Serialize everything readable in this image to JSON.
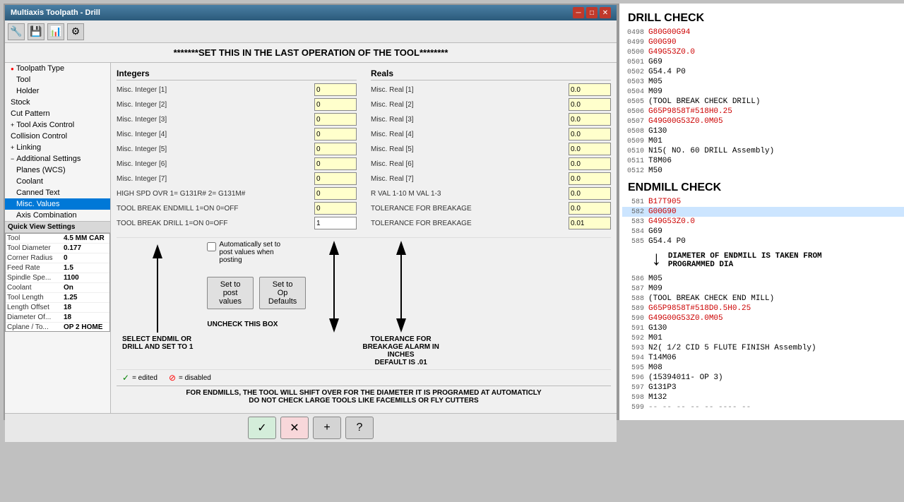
{
  "window": {
    "title": "Multiaxis Toolpath - Drill"
  },
  "toolbar": {
    "buttons": [
      "🔧",
      "💾",
      "📊",
      "⚙"
    ]
  },
  "header": {
    "title": "*******SET THIS IN THE LAST OPERATION OF THE TOOL********"
  },
  "sidebar": {
    "items": [
      {
        "id": "toolpath-type",
        "label": "Toolpath Type",
        "indent": 0,
        "icon": "●",
        "icon_color": "red"
      },
      {
        "id": "tool",
        "label": "Tool",
        "indent": 1,
        "icon": ""
      },
      {
        "id": "holder",
        "label": "Holder",
        "indent": 1,
        "icon": ""
      },
      {
        "id": "stock",
        "label": "Stock",
        "indent": 0,
        "icon": ""
      },
      {
        "id": "cut-pattern",
        "label": "Cut Pattern",
        "indent": 0,
        "icon": ""
      },
      {
        "id": "tool-axis-control",
        "label": "Tool Axis Control",
        "indent": 0,
        "icon": "+"
      },
      {
        "id": "collision-control",
        "label": "Collision Control",
        "indent": 0,
        "icon": ""
      },
      {
        "id": "linking",
        "label": "Linking",
        "indent": 0,
        "icon": "+"
      },
      {
        "id": "additional-settings",
        "label": "Additional Settings",
        "indent": 0,
        "icon": "-"
      },
      {
        "id": "planes-wcs",
        "label": "Planes (WCS)",
        "indent": 1,
        "icon": ""
      },
      {
        "id": "coolant",
        "label": "Coolant",
        "indent": 1,
        "icon": ""
      },
      {
        "id": "canned-text",
        "label": "Canned Text",
        "indent": 1,
        "icon": ""
      },
      {
        "id": "misc-values",
        "label": "Misc. Values",
        "indent": 1,
        "icon": "",
        "selected": true
      },
      {
        "id": "axis-combination",
        "label": "Axis Combination",
        "indent": 1,
        "icon": ""
      }
    ]
  },
  "quick_view": {
    "title": "Quick View Settings",
    "rows": [
      {
        "label": "Tool",
        "value": "4.5 MM CAR"
      },
      {
        "label": "Tool Diameter",
        "value": "0.177"
      },
      {
        "label": "Corner Radius",
        "value": "0"
      },
      {
        "label": "Feed Rate",
        "value": "1.5"
      },
      {
        "label": "Spindle Spe...",
        "value": "1100"
      },
      {
        "label": "Coolant",
        "value": "On"
      },
      {
        "label": "Tool Length",
        "value": "1.25"
      },
      {
        "label": "Length Offset",
        "value": "18"
      },
      {
        "label": "Diameter Of...",
        "value": "18"
      },
      {
        "label": "Cplane / To...",
        "value": "OP 2 HOME"
      }
    ]
  },
  "integers": {
    "title": "Integers",
    "rows": [
      {
        "label": "Misc. Integer [1]",
        "value": "0"
      },
      {
        "label": "Misc. Integer [2]",
        "value": "0"
      },
      {
        "label": "Misc. Integer [3]",
        "value": "0"
      },
      {
        "label": "Misc. Integer [4]",
        "value": "0"
      },
      {
        "label": "Misc. Integer [5]",
        "value": "0"
      },
      {
        "label": "Misc. Integer [6]",
        "value": "0"
      },
      {
        "label": "Misc. Integer [7]",
        "value": "0"
      },
      {
        "label": "HIGH SPD OVR 1= G131R# 2= G131M#",
        "value": "0"
      },
      {
        "label": "TOOL BREAK ENDMILL  1=ON 0=OFF",
        "value": "0"
      },
      {
        "label": "TOOL BREAK DRILL    1=ON 0=OFF",
        "value": "1"
      }
    ]
  },
  "reals": {
    "title": "Reals",
    "rows": [
      {
        "label": "Misc. Real [1]",
        "value": "0.0"
      },
      {
        "label": "Misc. Real [2]",
        "value": "0.0"
      },
      {
        "label": "Misc. Real [3]",
        "value": "0.0"
      },
      {
        "label": "Misc. Real [4]",
        "value": "0.0"
      },
      {
        "label": "Misc. Real [5]",
        "value": "0.0"
      },
      {
        "label": "Misc. Real [6]",
        "value": "0.0"
      },
      {
        "label": "Misc. Real [7]",
        "value": "0.0"
      },
      {
        "label": "R VAL 1-10 M VAL 1-3",
        "value": "0.0"
      },
      {
        "label": "TOLERANCE FOR BREAKAGE",
        "value": "0.0"
      },
      {
        "label": "TOLERANCE FOR BREAKAGE",
        "value": "0.01"
      }
    ]
  },
  "bottom_info": {
    "line1": "FOR ENDMILLS, THE TOOL WILL SHIFT OVER FOR THE DIAMETER IT IS PROGRAMED AT AUTOMATICLY",
    "line2": "DO NOT CHECK LARGE TOOLS LIKE FACEMILLS OR FLY CUTTERS"
  },
  "annotations": {
    "uncheck_box": "UNCHECK THIS BOX",
    "select_and_set": "SELECT ENDMIL OR\nDRILL AND SET TO 1",
    "tolerance": "TOLERANCE FOR\nBREAKAGE ALARM IN\nINCHES\nDEFAULT IS .01",
    "checkbox_auto": "Automatically set to\npost values when\nposting",
    "diameter_note": "DIAMETER OF ENDMILL IS TAKEN FROM\nPROGRAMMED DIA"
  },
  "buttons": {
    "set_to_post": "Set to post values",
    "set_to_op": "Set to Op Defaults",
    "ok": "✓",
    "cancel": "✕",
    "add": "+",
    "help": "?"
  },
  "legend": {
    "edited": "= edited",
    "disabled": "= disabled"
  },
  "drill_check": {
    "title": "DRILL CHECK",
    "lines": [
      {
        "num": "0498",
        "code": "G80G00G94",
        "style": "red"
      },
      {
        "num": "0499",
        "code": "G00G90",
        "style": "red"
      },
      {
        "num": "0500",
        "code": "G49G53Z0.0",
        "style": "red"
      },
      {
        "num": "0501",
        "code": "G69",
        "style": "black"
      },
      {
        "num": "0502",
        "code": "G54.4 P0",
        "style": "black"
      },
      {
        "num": "0503",
        "code": "M05",
        "style": "black"
      },
      {
        "num": "0504",
        "code": "M09",
        "style": "black"
      },
      {
        "num": "0505",
        "code": "(TOOL BREAK CHECK DRILL)",
        "style": "black"
      },
      {
        "num": "0506",
        "code": "G65P9858T#518H0.25",
        "style": "red"
      },
      {
        "num": "0507",
        "code": "G49G00G53Z0.0M05",
        "style": "red"
      },
      {
        "num": "0508",
        "code": "G130",
        "style": "black"
      },
      {
        "num": "0509",
        "code": "M01",
        "style": "black"
      },
      {
        "num": "0510",
        "code": "N15( NO. 60 DRILL Assembly)",
        "style": "black"
      },
      {
        "num": "0511",
        "code": "T8M06",
        "style": "black"
      },
      {
        "num": "0512",
        "code": "M50",
        "style": "black"
      }
    ]
  },
  "endmill_check": {
    "title": "ENDMILL CHECK",
    "lines": [
      {
        "num": "581",
        "code": "B17T905",
        "style": "red",
        "partial": true
      },
      {
        "num": "582",
        "code": "G00G90",
        "style": "red",
        "highlighted": true
      },
      {
        "num": "583",
        "code": "G49G53Z0.0",
        "style": "red"
      },
      {
        "num": "584",
        "code": "G69",
        "style": "black"
      },
      {
        "num": "585",
        "code": "G54.4 P0",
        "style": "black"
      },
      {
        "num": "586",
        "code": "M05",
        "style": "black"
      },
      {
        "num": "587",
        "code": "M09",
        "style": "black"
      },
      {
        "num": "588",
        "code": "(TOOL BREAK CHECK END MILL)",
        "style": "black"
      },
      {
        "num": "589",
        "code": "G65P9858T#518D0.5H0.25",
        "style": "red"
      },
      {
        "num": "590",
        "code": "G49G00G53Z0.0M05",
        "style": "red"
      },
      {
        "num": "591",
        "code": "G130",
        "style": "black"
      },
      {
        "num": "592",
        "code": "M01",
        "style": "black"
      },
      {
        "num": "593",
        "code": "N2( 1/2 CID 5 FLUTE FINISH Assembly)",
        "style": "black"
      },
      {
        "num": "594",
        "code": "T14M06",
        "style": "black"
      },
      {
        "num": "595",
        "code": "M08",
        "style": "black"
      },
      {
        "num": "596",
        "code": "(15394011- OP 3)",
        "style": "black"
      },
      {
        "num": "597",
        "code": "G131P3",
        "style": "black"
      },
      {
        "num": "598",
        "code": "M132",
        "style": "black"
      },
      {
        "num": "599",
        "code": "-- --  -- --  -- ----  --",
        "style": "gray"
      }
    ]
  }
}
